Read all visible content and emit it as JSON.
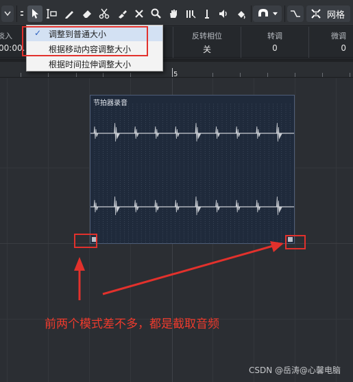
{
  "toolbar": {
    "tools": [
      "select-tool",
      "range-tool",
      "draw-tool",
      "erase-tool",
      "split-tool",
      "glue-tool",
      "mute-tool",
      "zoom-tool",
      "hand-tool",
      "comp-tool",
      "listen-tool",
      "color-tool"
    ],
    "grid_label": "网格"
  },
  "info": {
    "col1_label": "淡入",
    "col1_value": "00:00.",
    "col2_label": "反转相位",
    "col2_value": "关",
    "col3_label": "转调",
    "col3_value": "0",
    "col4_label": "微调",
    "col4_value": "0"
  },
  "ruler": {
    "bar_number": "5"
  },
  "menu": {
    "items": [
      {
        "label": "调整到普通大小",
        "checked": true
      },
      {
        "label": "根据移动内容调整大小",
        "checked": false
      },
      {
        "label": "根据时间拉伸调整大小",
        "checked": false
      }
    ],
    "check_glyph": "✓"
  },
  "event": {
    "title": "节拍器录音",
    "waveform_color": "#c9cdd3"
  },
  "annotation": {
    "text": "前两个模式差不多，都是截取音频",
    "color": "#e2312c"
  },
  "watermark": "CSDN @岳涛@心馨电脑"
}
